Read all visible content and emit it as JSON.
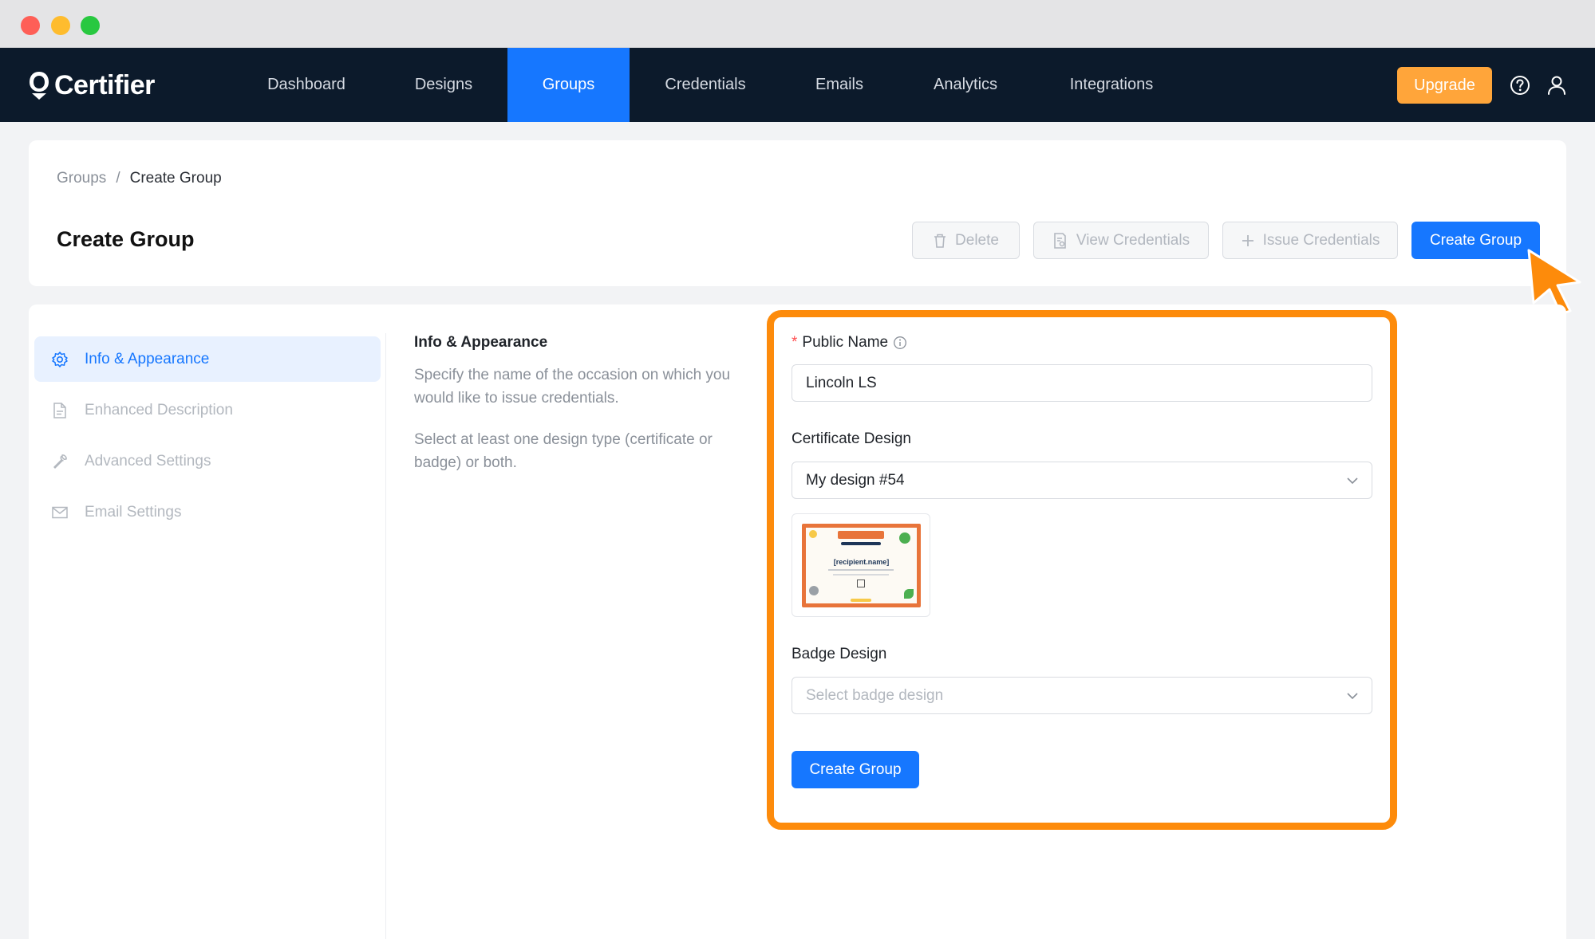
{
  "window": {
    "controls": [
      "close",
      "minimize",
      "maximize"
    ]
  },
  "brand": {
    "name": "Certifier",
    "logo_icon": "certifier-logo-icon"
  },
  "nav": {
    "items": [
      {
        "label": "Dashboard",
        "active": false
      },
      {
        "label": "Designs",
        "active": false
      },
      {
        "label": "Groups",
        "active": true
      },
      {
        "label": "Credentials",
        "active": false
      },
      {
        "label": "Emails",
        "active": false
      },
      {
        "label": "Analytics",
        "active": false
      },
      {
        "label": "Integrations",
        "active": false
      }
    ],
    "upgrade_label": "Upgrade",
    "help_icon": "help-icon",
    "user_icon": "user-icon"
  },
  "breadcrumb": {
    "parent": "Groups",
    "separator": "/",
    "current": "Create Group"
  },
  "header": {
    "title": "Create Group",
    "delete_label": "Delete",
    "view_credentials_label": "View Credentials",
    "issue_credentials_label": "Issue Credentials",
    "create_group_label": "Create Group"
  },
  "sidebar": {
    "items": [
      {
        "label": "Info & Appearance",
        "icon": "gear-icon",
        "active": true
      },
      {
        "label": "Enhanced Description",
        "icon": "document-icon",
        "active": false
      },
      {
        "label": "Advanced Settings",
        "icon": "wrench-icon",
        "active": false
      },
      {
        "label": "Email Settings",
        "icon": "mail-icon",
        "active": false
      }
    ]
  },
  "section": {
    "title": "Info & Appearance",
    "description1": "Specify the name of the occasion on which you would like to issue credentials.",
    "description2": "Select at least one design type (certificate or badge) or both."
  },
  "form": {
    "public_name": {
      "label": "Public Name",
      "required_mark": "*",
      "value": "Lincoln LS"
    },
    "certificate_design": {
      "label": "Certificate Design",
      "value": "My design #54",
      "preview_text": "[recipient.name]"
    },
    "badge_design": {
      "label": "Badge Design",
      "placeholder": "Select badge design"
    },
    "submit_label": "Create Group"
  },
  "colors": {
    "accent": "#1677ff",
    "upgrade": "#ffa53a",
    "highlight": "#fd8b0b",
    "nav_bg": "#0c1a2b"
  }
}
